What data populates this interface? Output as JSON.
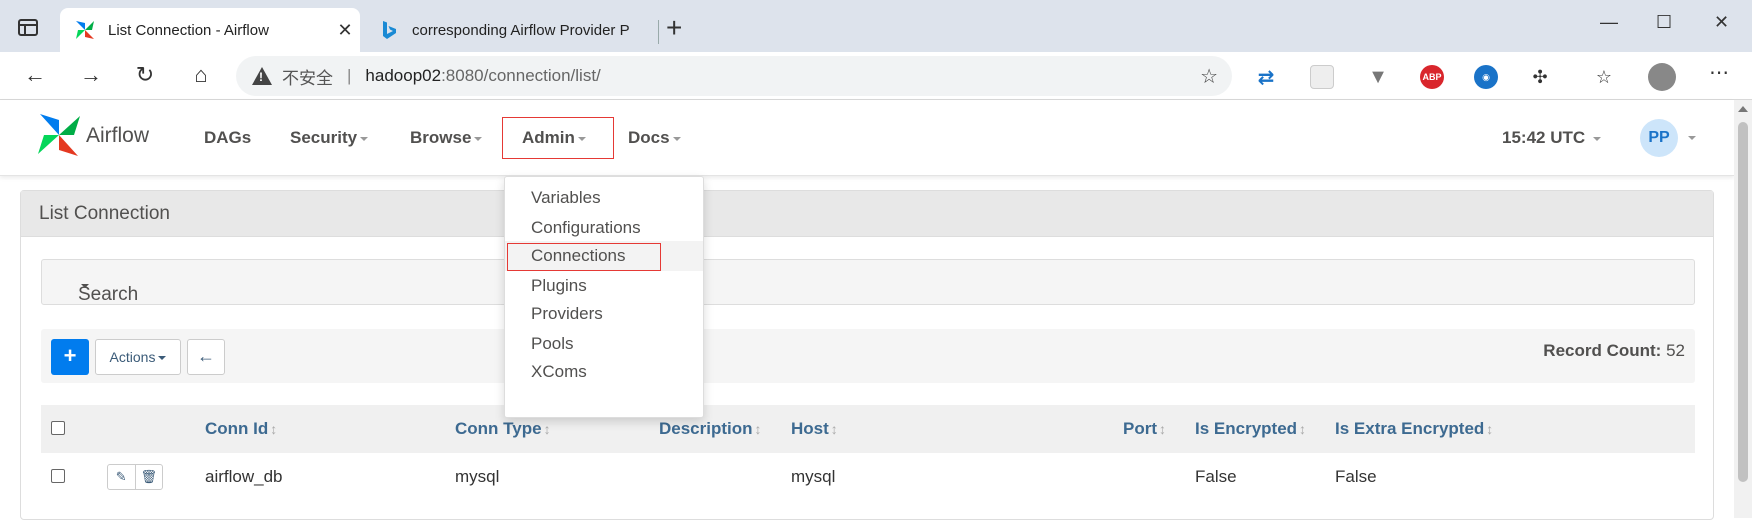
{
  "browser": {
    "tabs": [
      {
        "title": "List Connection - Airflow",
        "active": true,
        "close": "✕"
      },
      {
        "title": "corresponding Airflow Provider P",
        "active": false
      }
    ],
    "new_tab": "+",
    "window_controls": {
      "minimize": "—",
      "maximize": "☐",
      "close": "✕"
    },
    "address": {
      "not_secure": "不安全",
      "separator": "|",
      "host": "hadoop02",
      "path": ":8080/connection/list/"
    },
    "menu": "⋯"
  },
  "airflow": {
    "brand": "Airflow",
    "nav": [
      {
        "label": "DAGs",
        "caret": false
      },
      {
        "label": "Security",
        "caret": true
      },
      {
        "label": "Browse",
        "caret": true
      },
      {
        "label": "Admin",
        "caret": true,
        "highlighted": true
      },
      {
        "label": "Docs",
        "caret": true
      }
    ],
    "clock": "15:42 UTC",
    "user_initials": "PP",
    "admin_menu": [
      {
        "label": "Variables"
      },
      {
        "label": "Configurations"
      },
      {
        "label": "Connections",
        "highlighted": true
      },
      {
        "label": "Plugins"
      },
      {
        "label": "Providers"
      },
      {
        "label": "Pools"
      },
      {
        "label": "XComs"
      }
    ],
    "panel_title": "List Connection",
    "search_label": "Search",
    "toolbar": {
      "add_label": "+",
      "actions_label": "Actions",
      "back_label": "←",
      "record_count_label": "Record Count:",
      "record_count_value": "52"
    },
    "table": {
      "columns": [
        "Conn Id",
        "Conn Type",
        "Description",
        "Host",
        "Port",
        "Is Encrypted",
        "Is Extra Encrypted"
      ],
      "sort_glyph": "↕",
      "rows": [
        {
          "conn_id": "airflow_db",
          "conn_type": "mysql",
          "description": "",
          "host": "mysql",
          "port": "",
          "is_encrypted": "False",
          "is_extra_encrypted": "False"
        }
      ]
    }
  },
  "colors": {
    "accent": "#017cee",
    "highlight_border": "#e53935",
    "header_text": "#3d6a91"
  }
}
